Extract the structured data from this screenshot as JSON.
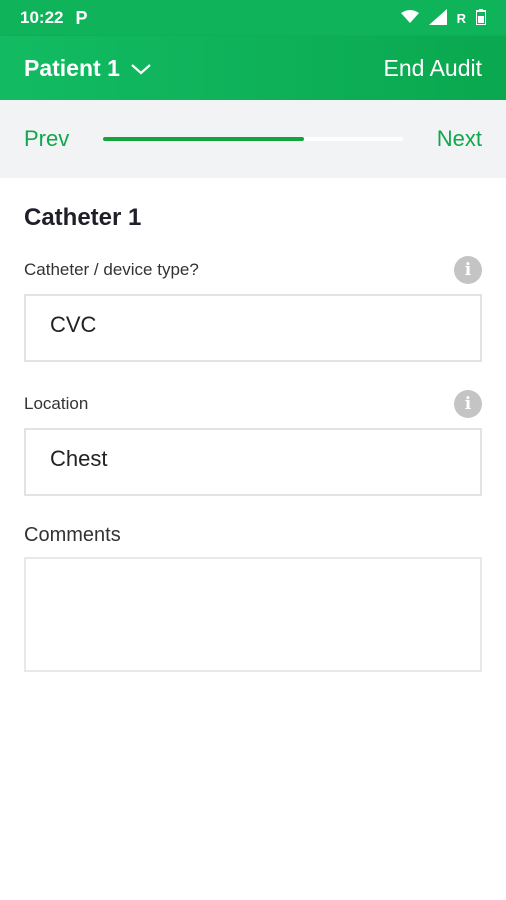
{
  "status": {
    "time": "10:22",
    "carrier_icon": "P",
    "network_label": "R",
    "colors": {
      "bar": "#0fb45a"
    }
  },
  "header": {
    "title": "Patient 1",
    "end_label": "End Audit",
    "accent": "#0fa84a"
  },
  "progress": {
    "prev_label": "Prev",
    "next_label": "Next",
    "fraction": 0.67
  },
  "form": {
    "title": "Catheter 1",
    "device_type": {
      "label": "Catheter / device type?",
      "value": "CVC"
    },
    "location": {
      "label": "Location",
      "value": "Chest"
    },
    "comments": {
      "label": "Comments",
      "value": ""
    }
  }
}
